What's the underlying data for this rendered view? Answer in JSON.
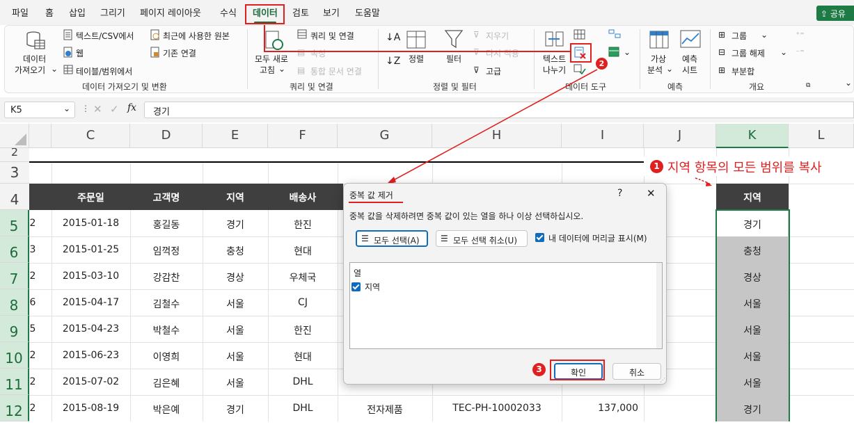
{
  "menu": {
    "tabs": [
      "파일",
      "홈",
      "삽입",
      "그리기",
      "페이지 레이아웃",
      "수식",
      "데이터",
      "검토",
      "보기",
      "도움말"
    ],
    "share": "공유"
  },
  "ribbon": {
    "get_data": {
      "data_fetch_line1": "데이터",
      "data_fetch_line2": "가져오기",
      "text_csv": "텍스트/CSV에서",
      "web": "웹",
      "table_range": "테이블/범위에서",
      "recent_sources": "최근에 사용한 원본",
      "existing_connections": "기존 연결",
      "label": "데이터 가져오기 및 변환"
    },
    "queries": {
      "refresh_all_line1": "모두 새로",
      "refresh_all_line2": "고침",
      "queries_connections": "쿼리 및 연결",
      "properties": "속성",
      "edit_links": "통합 문서 연결",
      "label": "쿼리 및 연결"
    },
    "sort_filter": {
      "sort": "정렬",
      "filter": "필터",
      "clear": "지우기",
      "reapply": "다시 적용",
      "advanced": "고급",
      "label": "정렬 및 필터"
    },
    "data_tools": {
      "text_to_columns_line1": "텍스트",
      "text_to_columns_line2": "나누기",
      "label": "데이터 도구"
    },
    "forecast": {
      "what_if_line1": "가상",
      "what_if_line2": "분석",
      "forecast_sheet_line1": "예측",
      "forecast_sheet_line2": "시트",
      "label": "예측"
    },
    "outline": {
      "group": "그룹",
      "ungroup": "그룹 해제",
      "subtotal": "부분합",
      "label": "개요"
    }
  },
  "formula_bar": {
    "name_box": "K5",
    "fx": "fx",
    "value": "경기"
  },
  "columns": [
    "C",
    "D",
    "E",
    "F",
    "G",
    "H",
    "I",
    "J",
    "K",
    "L"
  ],
  "rows": [
    "2",
    "3",
    "4",
    "5",
    "6",
    "7",
    "8",
    "9",
    "10",
    "11",
    "12"
  ],
  "table": {
    "headers": {
      "order_date": "주문일",
      "customer": "고객명",
      "region": "지역",
      "carrier": "배송사"
    },
    "rows": [
      {
        "b": "2",
        "date": "2015-01-18",
        "name": "홍길동",
        "region": "경기",
        "carrier": "한진"
      },
      {
        "b": "3",
        "date": "2015-01-25",
        "name": "임꺽정",
        "region": "충청",
        "carrier": "현대"
      },
      {
        "b": "2",
        "date": "2015-03-10",
        "name": "강감찬",
        "region": "경상",
        "carrier": "우체국"
      },
      {
        "b": "6",
        "date": "2015-04-17",
        "name": "김철수",
        "region": "서울",
        "carrier": "CJ"
      },
      {
        "b": "5",
        "date": "2015-04-23",
        "name": "박철수",
        "region": "서울",
        "carrier": "한진"
      },
      {
        "b": "2",
        "date": "2015-06-23",
        "name": "이영희",
        "region": "서울",
        "carrier": "현대"
      },
      {
        "b": "2",
        "date": "2015-07-02",
        "name": "김은혜",
        "region": "서울",
        "carrier": "DHL"
      },
      {
        "b": "2",
        "date": "2015-08-19",
        "name": "박은예",
        "region": "경기",
        "carrier": "DHL"
      }
    ],
    "row12_extra": {
      "category": "전자제품",
      "product_id": "TEC-PH-10002033",
      "amount": "137,000"
    }
  },
  "k_column": {
    "header": "지역",
    "values": [
      "경기",
      "충청",
      "경상",
      "서울",
      "서울",
      "서울",
      "서울",
      "경기"
    ]
  },
  "annotations": {
    "step1_num": "1",
    "step1_text": "지역 항목의 모든 범위를 복사",
    "step2_num": "2",
    "step3_num": "3"
  },
  "dialog": {
    "title": "중복 값 제거",
    "help": "?",
    "close": "✕",
    "description": "중복 값을 삭제하려면 중복 값이 있는 열을 하나 이상 선택하십시오.",
    "select_all": "모두 선택(A)",
    "unselect_all": "모두 선택 취소(U)",
    "has_headers": "내 데이터에 머리글 표시(M)",
    "list_header": "열",
    "list_item": "지역",
    "ok": "확인",
    "cancel": "취소"
  },
  "colors": {
    "accent_green": "#1e7b45",
    "annotation_red": "#e02020",
    "table_header_bg": "#3f3f3f",
    "k_selection_bg": "#c6c6c6"
  }
}
